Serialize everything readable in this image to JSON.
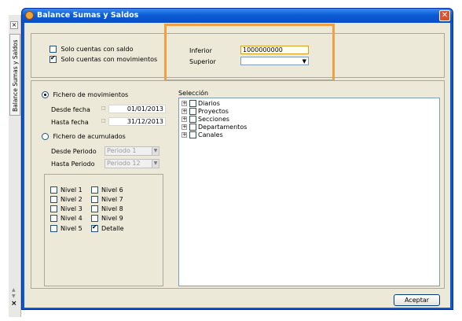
{
  "strip": {
    "tab_label": "Balance Sumas y Saldos",
    "close": "×",
    "bottom_close": "×"
  },
  "window": {
    "title": "Balance Sumas y Saldos",
    "close": "✕"
  },
  "top_options": {
    "solo_saldo": "Solo cuentas con saldo",
    "solo_movimientos": "Solo cuentas con movimientos"
  },
  "range": {
    "inferior_label": "Inferior",
    "inferior_value": "1000000000",
    "superior_label": "Superior",
    "superior_value": ""
  },
  "movimientos": {
    "radio_label": "Fichero de movimientos",
    "desde_label": "Desde fecha",
    "desde_value": "01/01/2013",
    "hasta_label": "Hasta fecha",
    "hasta_value": "31/12/2013"
  },
  "acumulados": {
    "radio_label": "Fichero de acumulados",
    "desde_label": "Desde Periodo",
    "desde_value": "Periodo 1",
    "hasta_label": "Hasta Periodo",
    "hasta_value": "Periodo 12"
  },
  "niveles": {
    "col1": [
      "Nivel 1",
      "Nivel 2",
      "Nivel 3",
      "Nivel 4",
      "Nivel 5"
    ],
    "col2": [
      "Nivel 6",
      "Nivel 7",
      "Nivel 8",
      "Nivel 9",
      "Detalle"
    ]
  },
  "seleccion": {
    "label": "Selección",
    "items": [
      "Diarios",
      "Proyectos",
      "Secciones",
      "Departamentos",
      "Canales"
    ]
  },
  "buttons": {
    "aceptar": "Aceptar"
  },
  "colors": {
    "highlight": "#f0a040",
    "title_bar": "#0a58d8"
  }
}
